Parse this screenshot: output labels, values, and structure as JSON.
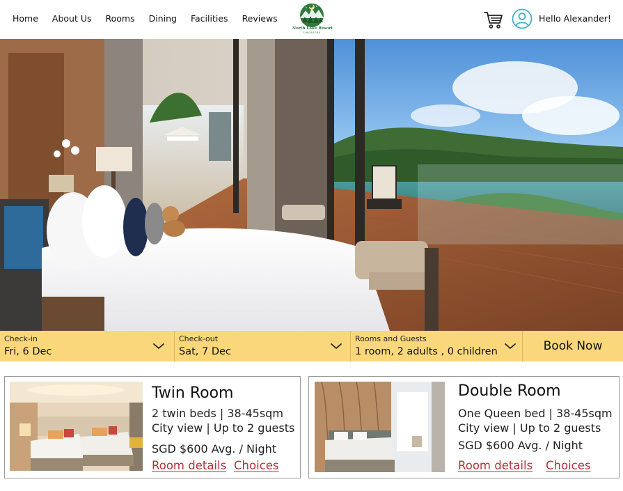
{
  "nav": {
    "items": [
      "Home",
      "About Us",
      "Rooms",
      "Dining",
      "Facilities",
      "Reviews"
    ]
  },
  "logo": {
    "name": "North Lake Resort",
    "location": "SINGAPORE",
    "color": "#2e7a3c"
  },
  "header": {
    "cart_icon": "cart-icon",
    "user_icon": "user-circle-icon",
    "greeting": "Hello Alexander!",
    "accent_color": "#3fb3c7"
  },
  "booking": {
    "color": "#fad77a",
    "checkin_label": "Check-in",
    "checkin_value": "Fri, 6 Dec",
    "checkout_label": "Check-out",
    "checkout_value": "Sat, 7 Dec",
    "guests_label": "Rooms and Guests",
    "guests_value": "1 room, 2 adults , 0 children",
    "book_label": "Book Now"
  },
  "rooms": [
    {
      "title": "Twin Room",
      "line1": "2 twin beds | 38-45sqm",
      "line2": "City view | Up to 2 guests",
      "price": "SGD $600 Avg. / Night",
      "details_label": "Room details",
      "choices_label": "Choices"
    },
    {
      "title": "Double Room",
      "line1": "One Queen bed | 38-45sqm",
      "line2": "City view | Up to 2 guests",
      "price": "SGD $600 Avg. / Night",
      "details_label": "Room details",
      "choices_label": "Choices"
    }
  ],
  "link_color": "#b8323a"
}
